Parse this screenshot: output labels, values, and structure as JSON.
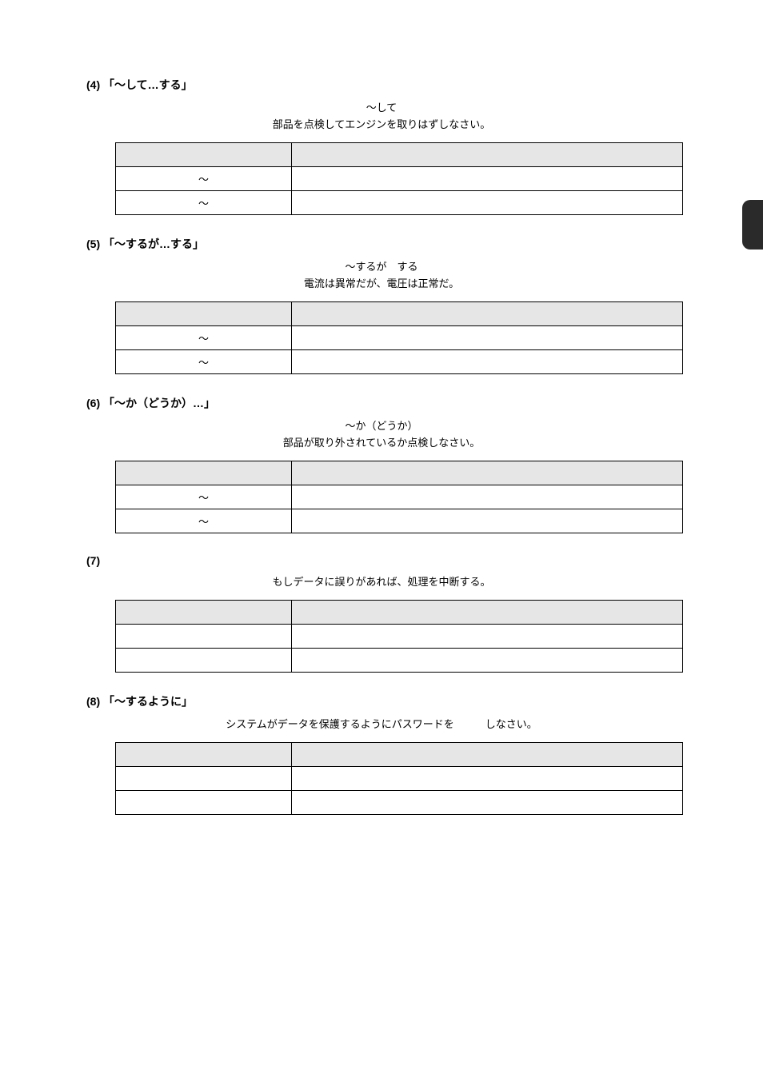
{
  "tabColor": "#2a2a2a",
  "sections": [
    {
      "num": "(4)",
      "title": "「～して…する」",
      "keyword": "～して",
      "example": "部品を点検してエンジンを取りはずしなさい。",
      "table": {
        "headers": [
          "",
          ""
        ],
        "rows": [
          [
            "～",
            ""
          ],
          [
            "～",
            ""
          ]
        ],
        "firstColClass": [
          "c",
          "c"
        ]
      }
    },
    {
      "num": "(5)",
      "title": "「～するが…する」",
      "keyword": "～するが　する",
      "example": "電流は異常だが、電圧は正常だ。",
      "table": {
        "headers": [
          "",
          ""
        ],
        "rows": [
          [
            "～",
            ""
          ],
          [
            "～",
            ""
          ]
        ],
        "firstColClass": [
          "c",
          "c"
        ]
      }
    },
    {
      "num": "(6)",
      "title": "「～か（どうか）…」",
      "keyword": "～か（どうか）",
      "example": "部品が取り外されているか点検しなさい。",
      "table": {
        "headers": [
          "",
          ""
        ],
        "rows": [
          [
            "～",
            ""
          ],
          [
            "～",
            ""
          ]
        ],
        "firstColClass": [
          "c",
          "c"
        ]
      }
    },
    {
      "num": "(7)",
      "title": "",
      "keyword": "",
      "example": "もしデータに誤りがあれば、処理を中断する。",
      "table": {
        "headers": [
          "",
          ""
        ],
        "rows": [
          [
            "",
            ""
          ],
          [
            "",
            ""
          ]
        ],
        "firstColClass": [
          "c",
          "c"
        ]
      }
    },
    {
      "num": "(8)",
      "title": "「～するように」",
      "keyword": "",
      "example": "システムがデータを保護するようにパスワードを　　　しなさい。",
      "table": {
        "headers": [
          "",
          ""
        ],
        "rows": [
          [
            "",
            ""
          ],
          [
            "",
            ""
          ]
        ],
        "firstColClass": [
          "c",
          "c"
        ]
      }
    }
  ]
}
